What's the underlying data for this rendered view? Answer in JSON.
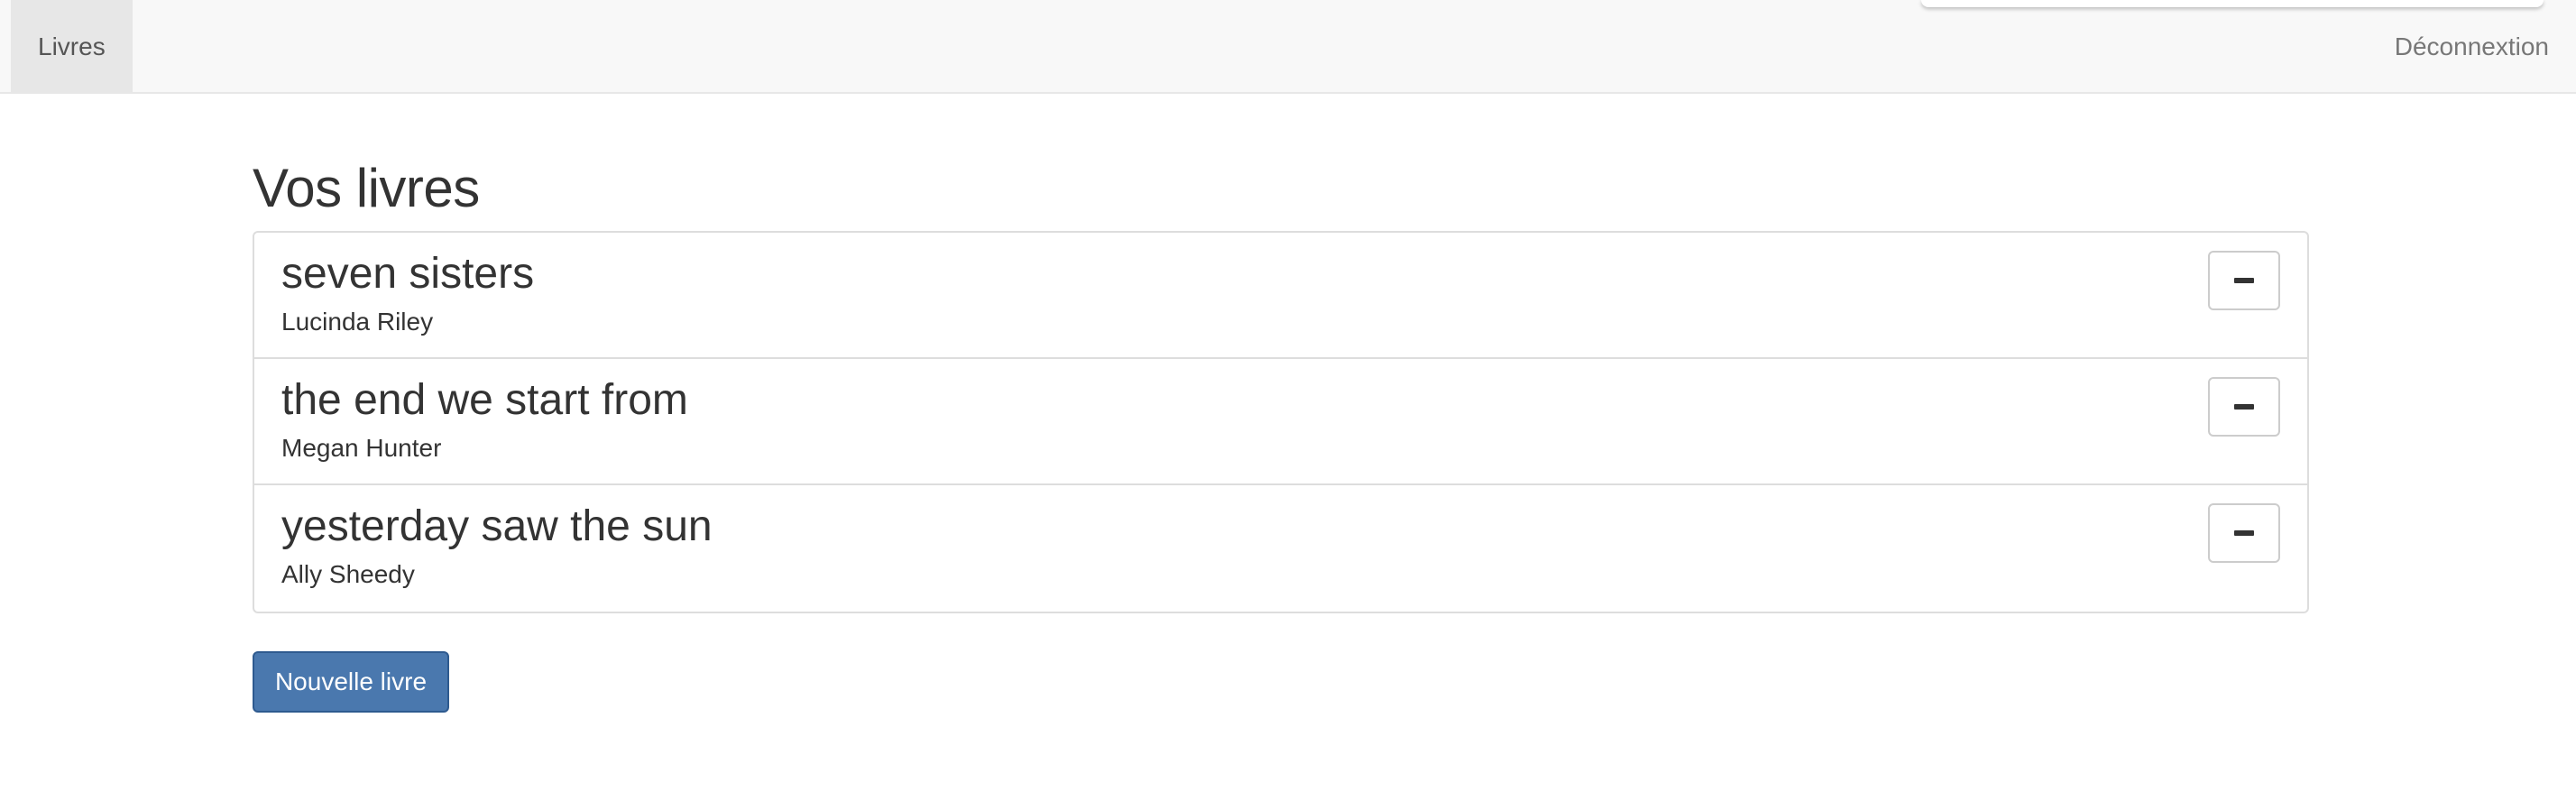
{
  "navbar": {
    "tab_label": "Livres",
    "logout_label": "Déconnextion"
  },
  "main": {
    "title": "Vos livres",
    "books": [
      {
        "title": "seven sisters",
        "author": "Lucinda Riley"
      },
      {
        "title": "the end we start from",
        "author": "Megan Hunter"
      },
      {
        "title": "yesterday saw the sun",
        "author": "Ally Sheedy"
      }
    ],
    "new_button_label": "Nouvelle livre"
  },
  "icons": {
    "remove": "minus-icon"
  },
  "colors": {
    "primary": "#4a78ae",
    "navbar_bg": "#f8f8f8",
    "active_tab_bg": "#e7e7e7",
    "border": "#dddddd"
  }
}
